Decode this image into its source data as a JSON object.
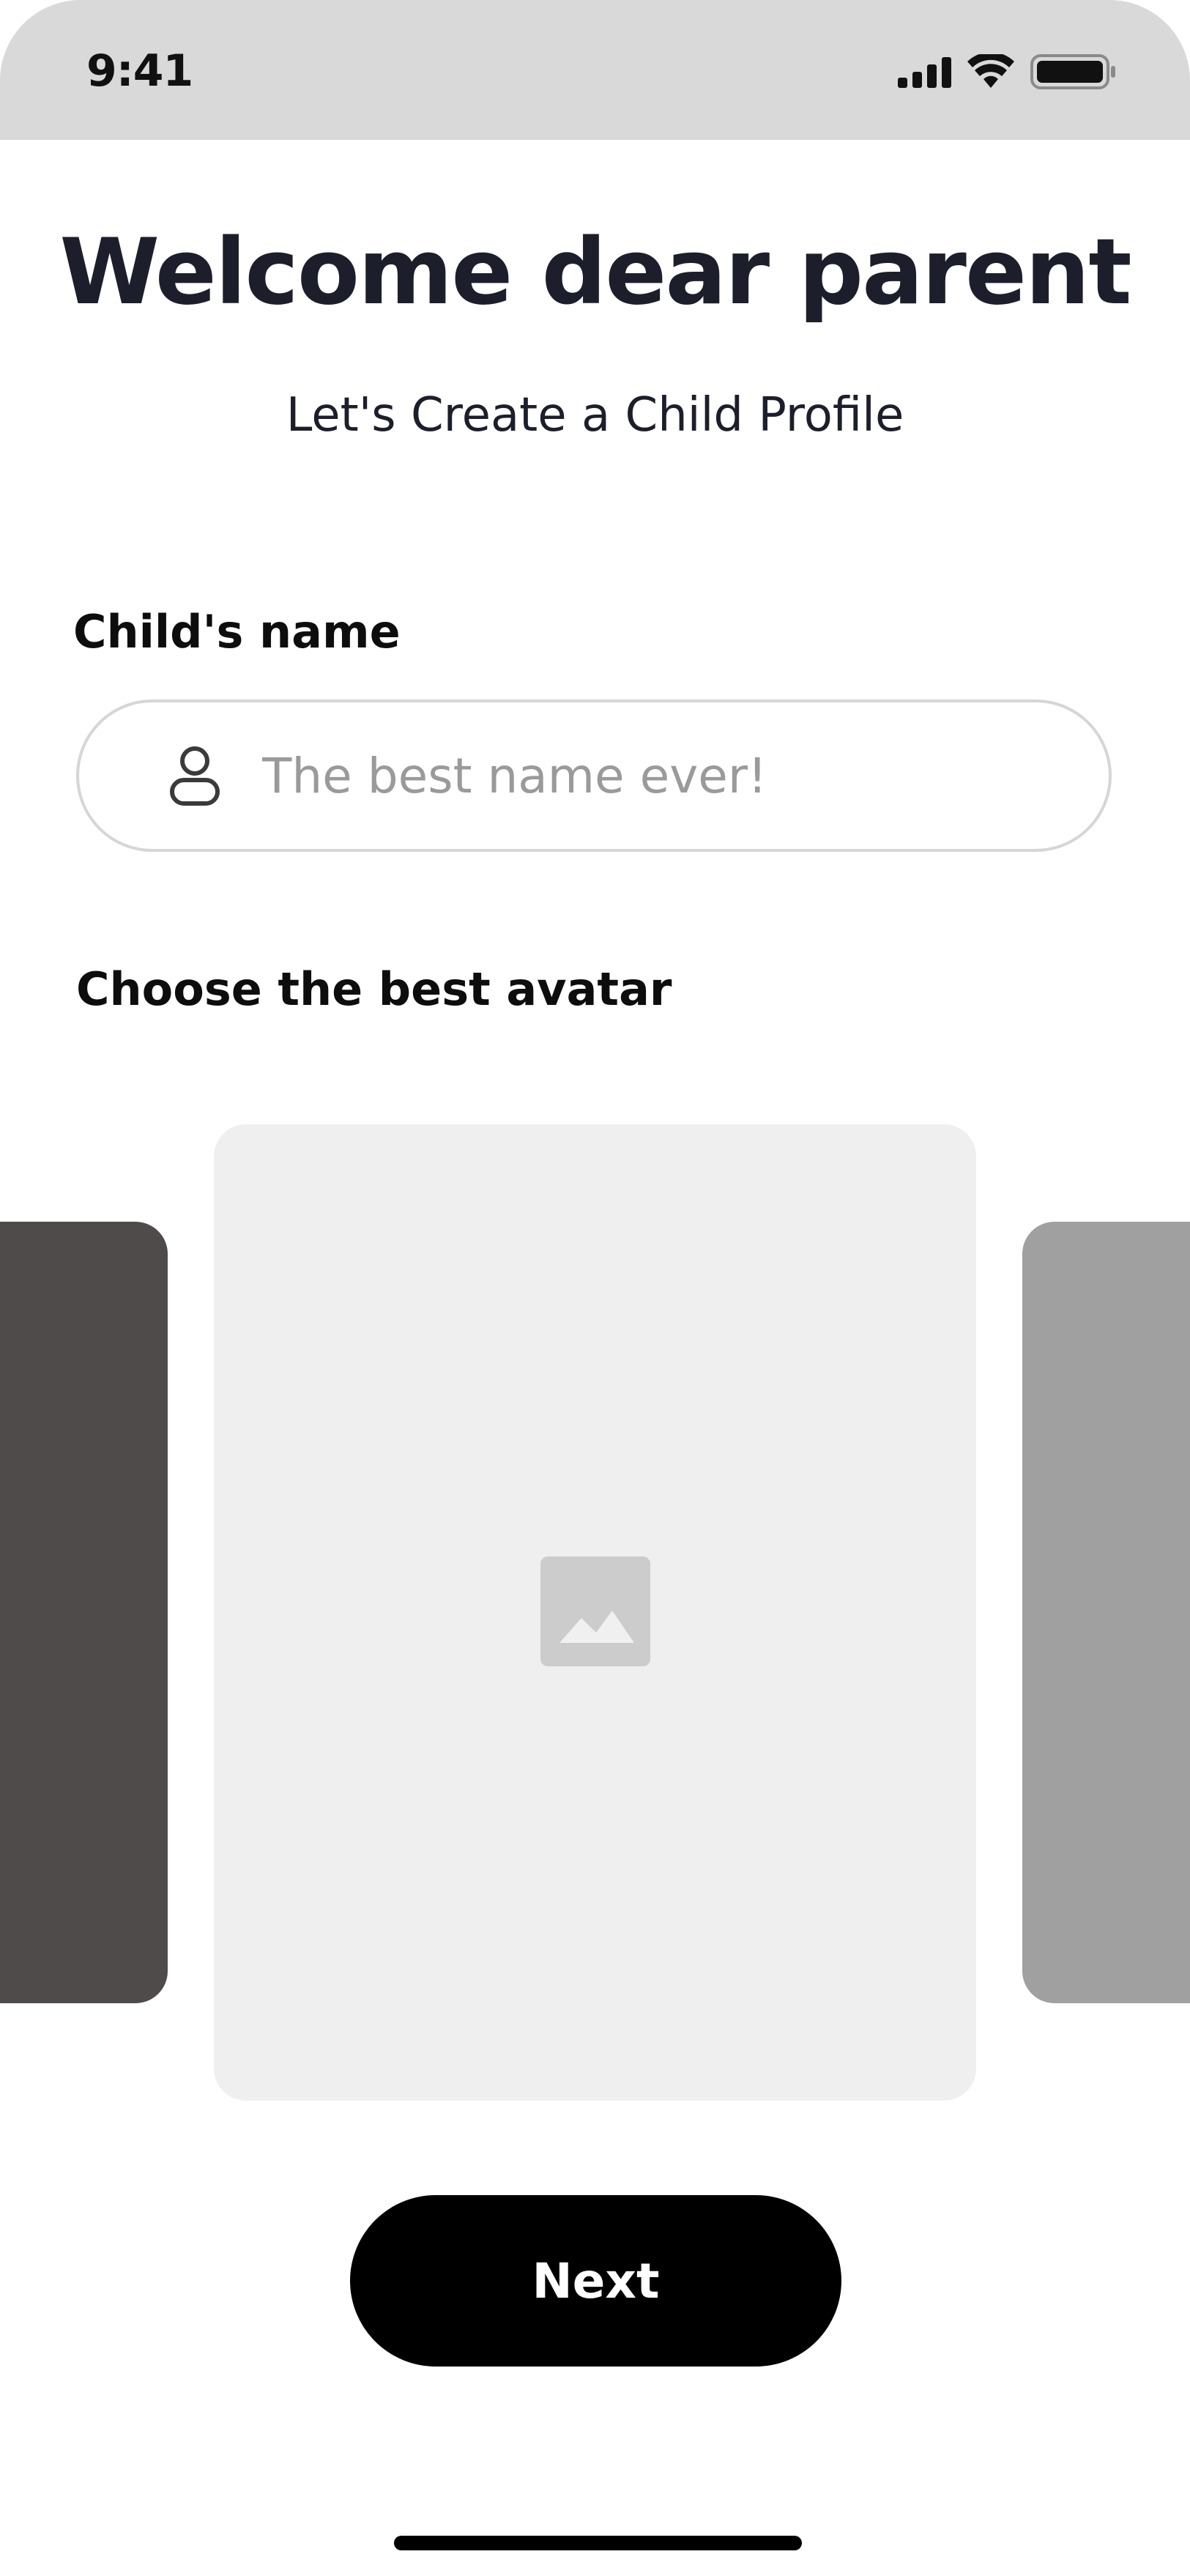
{
  "status_bar": {
    "time": "9:41",
    "icons": [
      "signal-icon",
      "wifi-icon",
      "battery-icon"
    ]
  },
  "header": {
    "title": "Welcome dear parent",
    "subtitle": "Let's Create a Child Profile"
  },
  "form": {
    "name_label": "Child's name",
    "name_placeholder": "The best name ever!",
    "name_value": "",
    "avatar_label": "Choose the best avatar"
  },
  "avatars": {
    "items": [
      "avatar-left",
      "avatar-center",
      "avatar-right"
    ],
    "selected_index": 1,
    "colors": {
      "left": "#4f4b4a",
      "center": "#efefef",
      "right": "#a0a0a0"
    }
  },
  "actions": {
    "next_label": "Next"
  },
  "colors": {
    "status_bar_bg": "#d9d9d9",
    "title": "#1c1f2b",
    "button_bg": "#000000",
    "button_text": "#ffffff",
    "placeholder": "#9a9a9a",
    "input_border": "#d6d6d6"
  }
}
